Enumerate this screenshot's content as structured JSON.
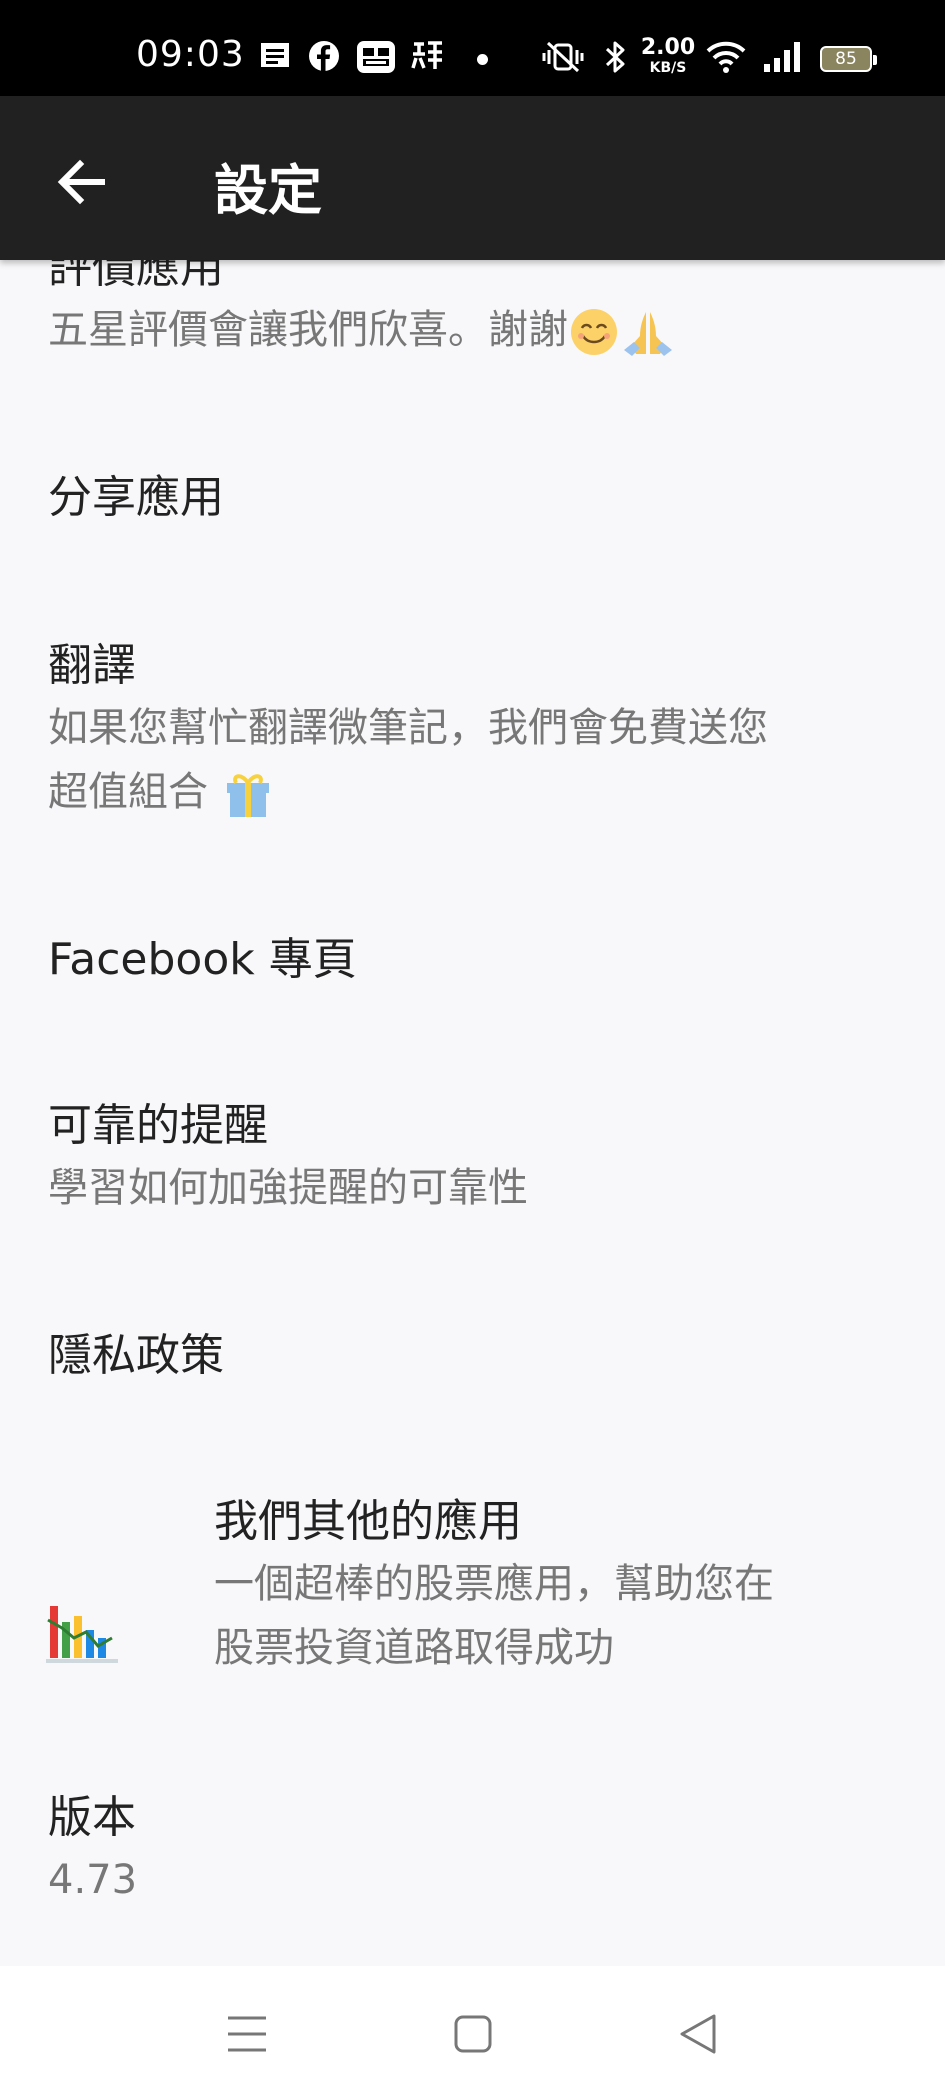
{
  "status_bar": {
    "time": "09:03",
    "network_speed": "2.00",
    "network_speed_unit": "KB/S",
    "battery": "85",
    "icons": [
      "sms-icon",
      "facebook-icon",
      "app-icon",
      "chinese-app-icon",
      "dot-icon",
      "vibrate-off-icon",
      "bluetooth-icon",
      "wifi-icon",
      "signal-icon",
      "battery-icon"
    ]
  },
  "app_bar": {
    "title": "設定",
    "back_icon": "arrow-left-icon"
  },
  "settings": {
    "rate": {
      "title": "評價應用",
      "subtitle": "五星評價會讓我們欣喜。謝謝"
    },
    "share": {
      "title": "分享應用"
    },
    "translate": {
      "title": "翻譯",
      "subtitle_line1": "如果您幫忙翻譯微筆記，我們會免費送您",
      "subtitle_line2": "超值組合"
    },
    "facebook": {
      "title": "Facebook 專頁"
    },
    "reminders": {
      "title": "可靠的提醒",
      "subtitle": "學習如何加強提醒的可靠性"
    },
    "privacy": {
      "title": "隱私政策"
    },
    "other_apps": {
      "title": "我們其他的應用",
      "subtitle_line1": "一個超棒的股票應用，幫助您在",
      "subtitle_line2": "股票投資道路取得成功",
      "icon": "stock-chart-icon"
    },
    "version": {
      "title": "版本",
      "value": "4.73"
    }
  },
  "nav_bar": {
    "menu_icon": "menu-icon",
    "home_icon": "home-square-icon",
    "back_icon": "back-triangle-icon"
  },
  "colors": {
    "status_bar_bg": "#000000",
    "app_bar_bg": "#212121",
    "list_bg": "#f8f8fa",
    "title_text": "#222222",
    "subtitle_text": "#777777",
    "nav_bar_bg": "#ffffff"
  }
}
